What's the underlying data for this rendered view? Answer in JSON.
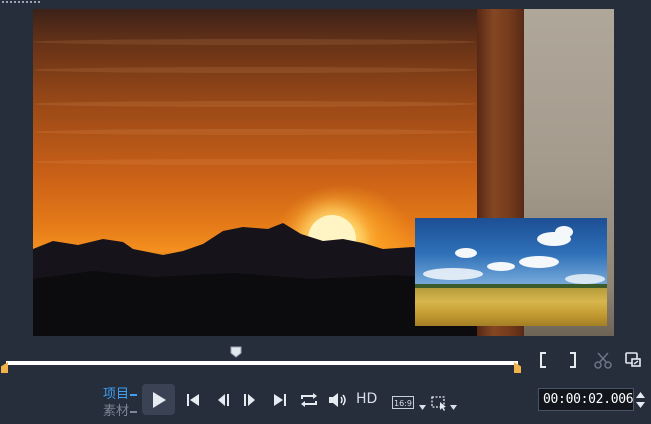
{
  "toolbar": {
    "mode_project_label": "项目",
    "mode_clip_label": "素材",
    "hd_label": "HD",
    "aspect_ratio_label": "16:9",
    "timecode": "00:00:02.006"
  },
  "icons": {
    "play": "play-icon",
    "home": "go-to-start-icon",
    "prev_frame": "previous-frame-icon",
    "next_frame": "next-frame-icon",
    "end": "go-to-end-icon",
    "repeat": "repeat-icon",
    "volume": "volume-icon",
    "mark_in": "mark-in-icon",
    "mark_out": "mark-out-icon",
    "split": "scissors-icon",
    "enlarge": "enlarge-preview-icon",
    "snapshot": "snapshot-select-icon"
  },
  "colors": {
    "background": "#262d3b",
    "accent": "#3f9ff0",
    "trim_handle": "#f0b24a"
  },
  "scrubber": {
    "playhead_fraction": 0.45
  }
}
